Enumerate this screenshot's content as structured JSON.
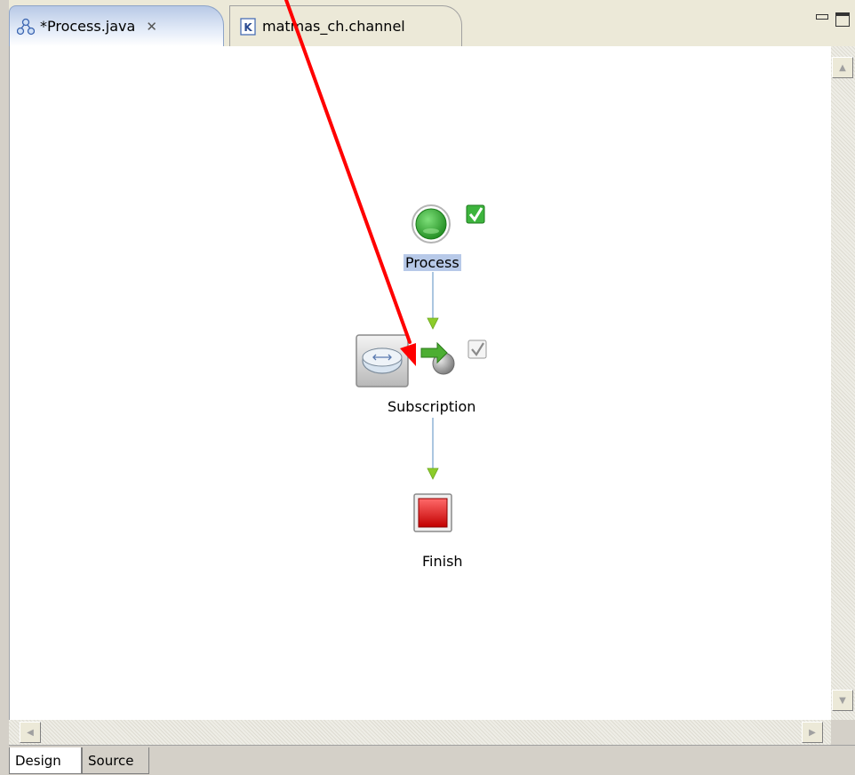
{
  "tabs": [
    {
      "label": "*Process.java",
      "active": true,
      "icon": "process-diagram-icon"
    },
    {
      "label": "matmas_ch.channel",
      "active": false,
      "icon": "channel-file-icon"
    }
  ],
  "diagram": {
    "nodes": [
      {
        "label": "Process",
        "icon": "start-event-icon",
        "status": "valid-checkmark-icon",
        "selected": true
      },
      {
        "label": "Subscription",
        "icon": "router-icon",
        "status": "valid-checkmark-icon"
      },
      {
        "label": "Finish",
        "icon": "stop-event-icon"
      }
    ]
  },
  "bottom_tabs": [
    {
      "label": "Design",
      "active": true
    },
    {
      "label": "Source",
      "active": false
    }
  ],
  "colors": {
    "annotation_arrow": "#ff0000",
    "start_node": "#2fa12f",
    "finish_node": "#e00000",
    "connector": "#8fb2d6",
    "connector_arrow": "#8ccc2a"
  }
}
